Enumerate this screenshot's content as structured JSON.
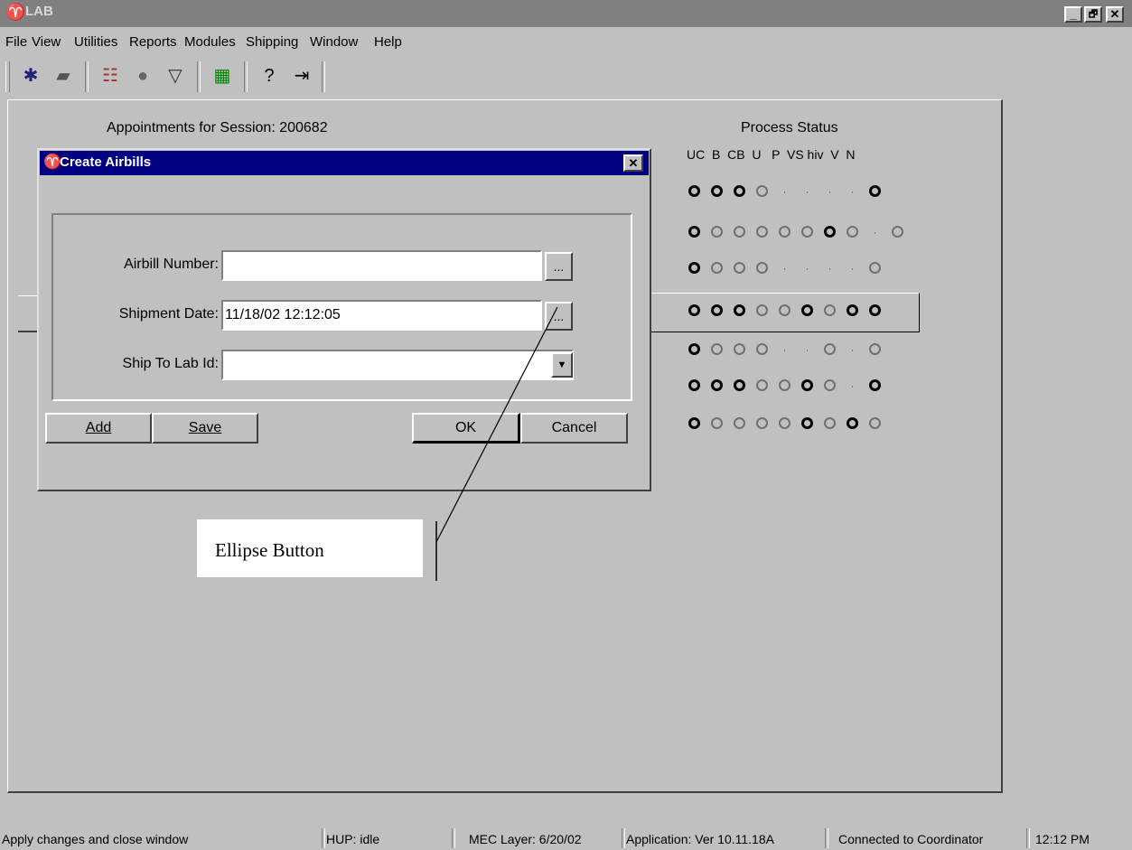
{
  "window": {
    "title": "LAB",
    "minimize": "_",
    "restore": "🗗",
    "close": "✕"
  },
  "menu": [
    {
      "label": "File"
    },
    {
      "label": "View"
    },
    {
      "label": "Utilities"
    },
    {
      "label": "Reports"
    },
    {
      "label": "Modules"
    },
    {
      "label": "Shipping"
    },
    {
      "label": "Window"
    },
    {
      "label": "Help"
    }
  ],
  "toolbar": {
    "icons": [
      "new-icon",
      "open-icon",
      "participants-icon",
      "specimen-icon",
      "inspect-icon",
      "reports-icon",
      "help-icon",
      "exit-icon"
    ]
  },
  "main": {
    "appointments_title": "Appointments for Session: 200682",
    "process_status_title": "Process Status",
    "process_columns": "UC  B  CB  U   P  VS hiv  V  N",
    "rows": [
      [
        "b",
        "b",
        "b",
        "g",
        "d",
        "d",
        "d",
        "d",
        "b"
      ],
      [
        "b",
        "g",
        "g",
        "g",
        "g",
        "g",
        "b",
        "g",
        "d",
        "g"
      ],
      [
        "b",
        "g",
        "g",
        "g",
        "d",
        "d",
        "d",
        "d",
        "g"
      ],
      [
        "b",
        "b",
        "b",
        "g",
        "g",
        "b",
        "g",
        "b",
        "b"
      ],
      [
        "b",
        "g",
        "g",
        "g",
        "d",
        "d",
        "g",
        "d",
        "g"
      ],
      [
        "b",
        "b",
        "b",
        "g",
        "g",
        "b",
        "g",
        "d",
        "b"
      ],
      [
        "b",
        "g",
        "g",
        "g",
        "g",
        "b",
        "g",
        "b",
        "g"
      ]
    ]
  },
  "dialog": {
    "title": "Create Airbills",
    "close": "✕",
    "airbill_label": "Airbill Number:",
    "airbill_value": "",
    "shipment_label": "Shipment Date:",
    "shipment_value": "11/18/02 12:12:05",
    "shipto_label": "Ship To Lab Id:",
    "shipto_value": "",
    "ellipsis": "...",
    "add": "Add",
    "save": "Save",
    "ok": "OK",
    "cancel": "Cancel"
  },
  "callout": {
    "text": "Ellipse Button"
  },
  "status": {
    "message": "Apply changes and close window",
    "hup": "HUP: idle",
    "mec_layer": "MEC Layer: 6/20/02",
    "application": "Application: Ver 10.11.18A",
    "connection": "Connected to Coordinator",
    "time": "12:12 PM"
  }
}
